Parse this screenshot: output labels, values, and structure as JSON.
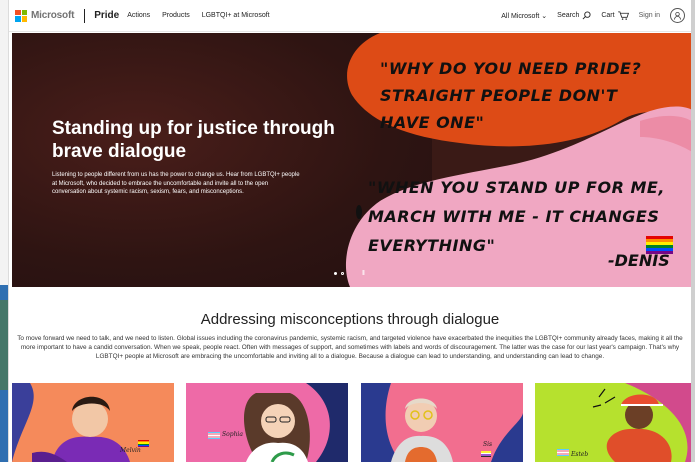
{
  "header": {
    "brand": "Microsoft",
    "site_title": "Pride",
    "nav": [
      "Actions",
      "Products",
      "LGBTQI+ at Microsoft"
    ],
    "all_microsoft": "All Microsoft",
    "search": "Search",
    "cart": "Cart",
    "sign_in": "Sign in"
  },
  "hero": {
    "title": "Standing up for justice through brave dialogue",
    "description": "Listening to people different from us has the power to change us. Hear from LGBTQI+ people at Microsoft, who decided to embrace the uncomfortable and invite all to the open conversation about systemic racism, sexism, fears, and misconceptions.",
    "quote_1": "\"WHY DO YOU NEED PRIDE? STRAIGHT PEOPLE DON'T HAVE ONE\"",
    "quote_2": "\"WHEN YOU STAND UP FOR ME, MARCH WITH ME - IT CHANGES EVERYTHING\"",
    "quote_2_author": "-DENIS",
    "carousel_pause": "II"
  },
  "section": {
    "title": "Addressing misconceptions through dialogue",
    "body": "To move forward we need to talk, and we need to listen. Global issues including the coronavirus pandemic, systemic racism, and targeted violence have exacerbated the inequities the LGBTQI+ community already faces, making it all the more important to have a candid conversation. When we speak, people react. Often with messages of support, and sometimes with labels and words of discouragement. The latter was the case for our last year's campaign. That's why LGBTQI+ people at Microsoft are embracing the uncomfortable and inviting all to a dialogue. Because a dialogue can lead to understanding, and understanding can lead to change."
  },
  "cards": [
    {
      "signature": "Melvin",
      "bg": "#f58a5b"
    },
    {
      "signature": "Sophia",
      "bg": "#ee6aa7"
    },
    {
      "signature": "Sis",
      "bg": "#f26e8f"
    },
    {
      "signature": "Esteb",
      "bg": "#b6e12e"
    }
  ],
  "colors": {
    "hero_dark": "#2e1412",
    "orange_blob": "#dd4b16",
    "pink_blob": "#f0a7c2",
    "accent_blue": "#0067b8"
  }
}
